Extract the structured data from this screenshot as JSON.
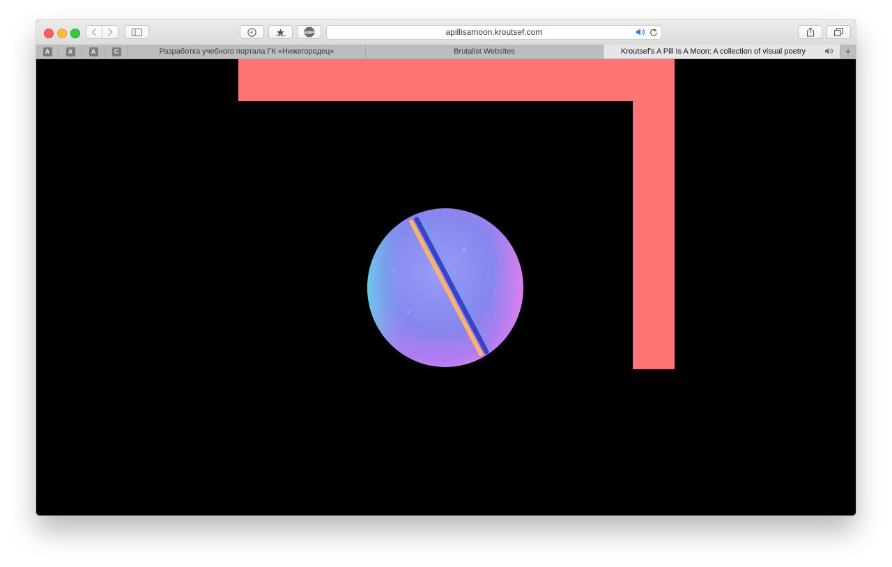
{
  "browser": {
    "url": "apillisamoon.kroutsef.com",
    "pinned_tabs": [
      {
        "letter": "A"
      },
      {
        "letter": "A"
      },
      {
        "letter": "A"
      },
      {
        "letter": "C"
      }
    ],
    "tabs": [
      {
        "title": "Разработка учебного портала ГК «Нижегородец»",
        "active": false
      },
      {
        "title": "Brutalist Websites",
        "active": false
      },
      {
        "title": "Kroutsef's A Pill Is A Moon: A collection of visual poetry",
        "active": true,
        "playing_audio": true
      }
    ],
    "new_tab_label": "+",
    "icons": {
      "back": "chevron-left-icon",
      "forward": "chevron-right-icon",
      "sidebar": "sidebar-icon",
      "history": "clock-icon",
      "bookmarks": "star-icon",
      "adblock": "abp-icon",
      "audio": "speaker-icon",
      "reload": "reload-icon",
      "share": "share-icon",
      "tabs_overview": "tabs-overview-icon"
    },
    "adblock_label": "ABP"
  },
  "page": {
    "background": "#000000",
    "accent": "#ff7474",
    "pill_colors": [
      "#8a8cf4",
      "#c87ef2",
      "#5ad6e8",
      "#ffb36a"
    ]
  }
}
